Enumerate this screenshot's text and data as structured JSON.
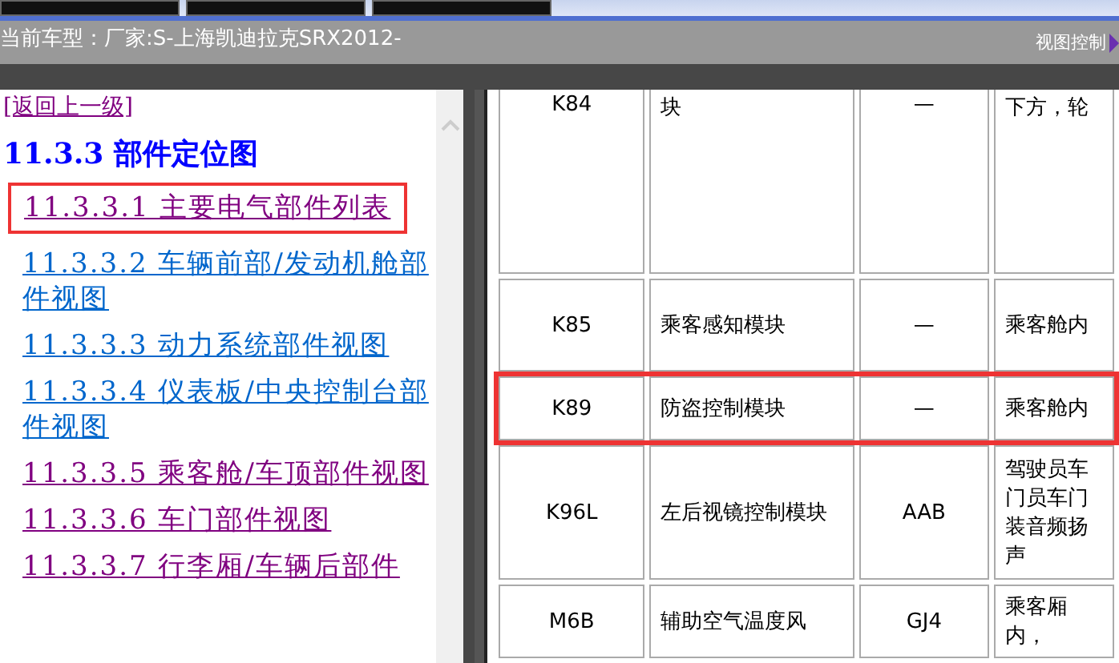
{
  "header": {
    "car_model": "当前车型：厂家:S-上海凯迪拉克SRX2012-",
    "view_control": "视图控制"
  },
  "nav": {
    "back_link": "[返回上一级]",
    "heading": "11.3.3 部件定位图",
    "links": [
      {
        "label": "11.3.3.1 主要电气部件列表",
        "visited": true,
        "highlighted": true
      },
      {
        "label": "11.3.3.2 车辆前部/发动机舱部件视图",
        "visited": false,
        "highlighted": false
      },
      {
        "label": "11.3.3.3 动力系统部件视图",
        "visited": false,
        "highlighted": false
      },
      {
        "label": "11.3.3.4 仪表板/中央控制台部件视图",
        "visited": false,
        "highlighted": false
      },
      {
        "label": "11.3.3.5 乘客舱/车顶部件视图",
        "visited": true,
        "highlighted": false
      },
      {
        "label": "11.3.3.6 车门部件视图",
        "visited": true,
        "highlighted": false
      },
      {
        "label": "11.3.3.7 行李厢/车辆后部件",
        "visited": true,
        "highlighted": false
      }
    ]
  },
  "table": {
    "rows": [
      {
        "code": "K84",
        "name": "块",
        "connector": "—",
        "location": "下方，轮",
        "highlighted": false
      },
      {
        "code": "K85",
        "name": "乘客感知模块",
        "connector": "—",
        "location": "乘客舱内",
        "highlighted": false
      },
      {
        "code": "K89",
        "name": "防盗控制模块",
        "connector": "—",
        "location": "乘客舱内",
        "highlighted": true
      },
      {
        "code": "K96L",
        "name": "左后视镜控制模块",
        "connector": "AAB",
        "location": "驾驶员车门员车门装音频扬声",
        "highlighted": false
      },
      {
        "code": "M6B",
        "name": "辅助空气温度风",
        "connector": "GJ4",
        "location": "乘客厢内，",
        "highlighted": false
      }
    ]
  }
}
